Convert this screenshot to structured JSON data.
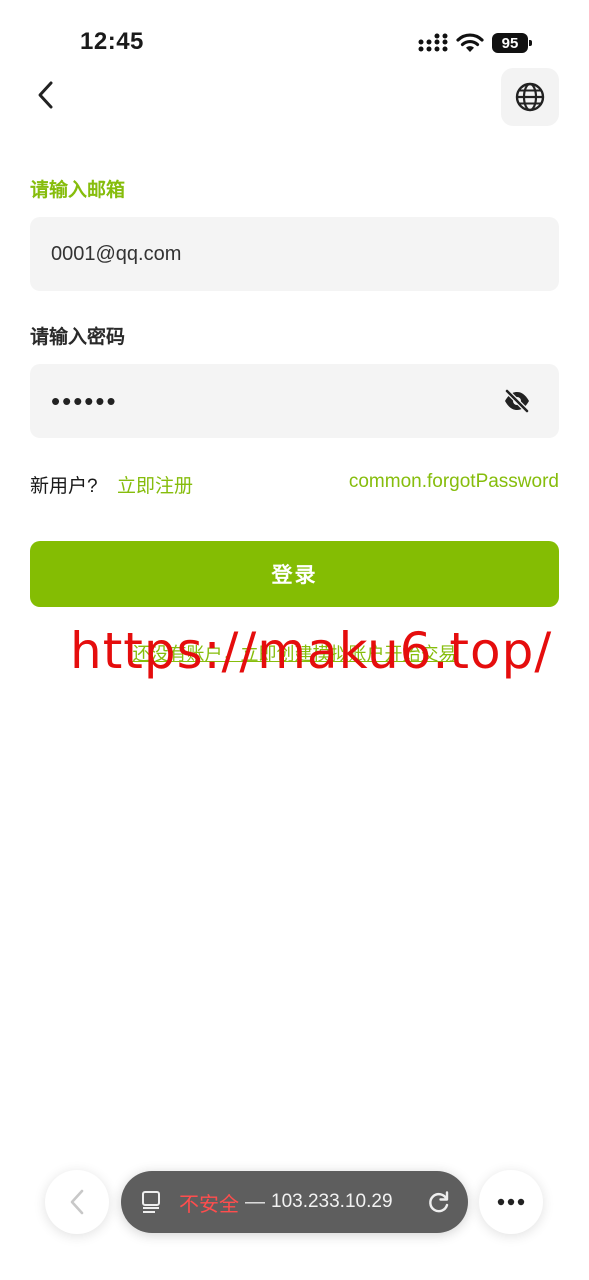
{
  "status_bar": {
    "time": "12:45",
    "battery": "95"
  },
  "header": {
    "back_icon": "chevron-left-icon",
    "language_icon": "globe-icon"
  },
  "form": {
    "email_label": "请输入邮箱",
    "email_value": "0001@qq.com",
    "password_label": "请输入密码",
    "password_value": "••••••",
    "password_toggle_icon": "eye-off-icon",
    "new_user_text": "新用户?",
    "register_link": "立即注册",
    "forgot_link": "common.forgotPassword",
    "login_button": "登录",
    "promo_link": "还没有账户，立即创建模拟账户开始交易"
  },
  "watermark": "https://maku6.top/",
  "browser": {
    "insecure_label": "不安全",
    "separator": "—",
    "url": "103.233.10.29"
  },
  "colors": {
    "accent": "#84bd03",
    "insecure": "#ff4d4d",
    "watermark": "#e50d0d"
  }
}
